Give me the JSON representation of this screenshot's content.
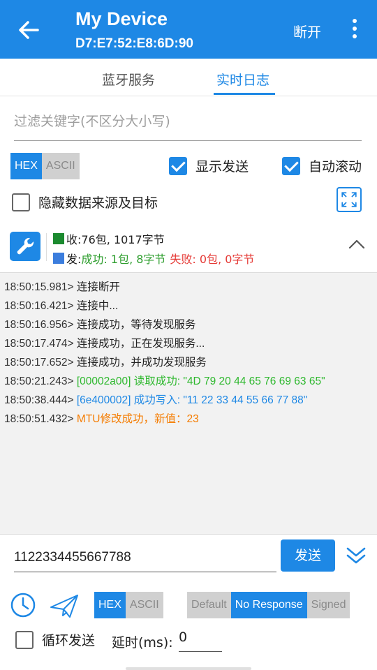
{
  "app_bar": {
    "title": "My Device",
    "subtitle": "D7:E7:52:E8:6D:90",
    "disconnect_label": "断开",
    "back_icon": "arrow-left-icon",
    "more_icon": "more-vert-icon"
  },
  "tabs": [
    {
      "label": "蓝牙服务",
      "selected": false
    },
    {
      "label": "实时日志",
      "selected": true
    }
  ],
  "filter": {
    "placeholder": "过滤关键字(不区分大小写)",
    "value": ""
  },
  "display_format": {
    "options": [
      "HEX",
      "ASCII"
    ],
    "selected": "HEX"
  },
  "options": {
    "show_send": {
      "label": "显示发送",
      "checked": true
    },
    "auto_scroll": {
      "label": "自动滚动",
      "checked": true
    },
    "hide_source": {
      "label": "隐藏数据来源及目标",
      "checked": false
    }
  },
  "stats": {
    "recv_prefix": "收:",
    "recv_text": "76包, 1017字节",
    "send_prefix": "发:",
    "send_success": "成功: 1包, 8字节",
    "send_fail": "失败: 0包, 0字节",
    "recv_color": "#1b8a2f",
    "send_color": "#3b7ddd"
  },
  "log": [
    {
      "time": "18:50:15.981>",
      "text": "连接断开",
      "kind": "normal"
    },
    {
      "time": "18:50:16.421>",
      "text": "连接中...",
      "kind": "normal"
    },
    {
      "time": "18:50:16.956>",
      "text": "连接成功，等待发现服务",
      "kind": "normal"
    },
    {
      "time": "18:50:17.474>",
      "text": "连接成功，正在发现服务...",
      "kind": "normal"
    },
    {
      "time": "18:50:17.652>",
      "text": "连接成功，并成功发现服务",
      "kind": "normal"
    },
    {
      "time": "18:50:21.243>",
      "text": "[00002a00] 读取成功: \"4D 79 20 44 65 76 69 63 65\"",
      "kind": "ok"
    },
    {
      "time": "18:50:38.444>",
      "text": "[6e400002] 成功写入: \"11 22 33 44 55 66 77 88\"",
      "kind": "write"
    },
    {
      "time": "18:50:51.432>",
      "text": "MTU修改成功，新值：23",
      "kind": "mtu"
    }
  ],
  "send": {
    "value": "1122334455667788",
    "button_label": "发送"
  },
  "send_format": {
    "options": [
      "HEX",
      "ASCII"
    ],
    "selected": "HEX"
  },
  "write_type": {
    "options": [
      "Default",
      "No Response",
      "Signed"
    ],
    "selected": "No Response"
  },
  "loop": {
    "label": "循环发送",
    "checked": false,
    "delay_label": "延时(ms):",
    "delay_value": "0"
  },
  "colors": {
    "accent": "#1e88e5",
    "success": "#2eb82e",
    "fail": "#e53935",
    "mtu": "#f57c00"
  }
}
